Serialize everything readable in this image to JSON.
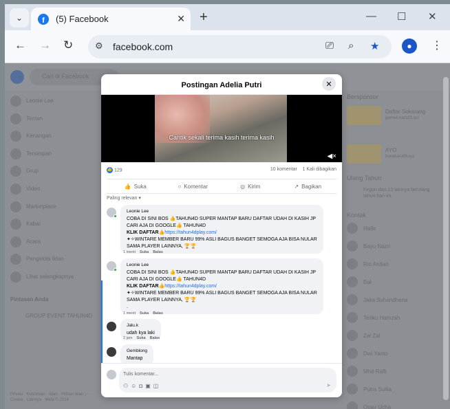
{
  "browser": {
    "tab_title": "(5) Facebook",
    "fb_favicon": "f",
    "url": "facebook.com",
    "icons": [
      "tab-search-icon",
      "close-icon",
      "new-tab-icon",
      "minimize-icon",
      "maximize-icon",
      "close-window-icon",
      "back-icon",
      "forward-icon",
      "reload-icon",
      "site-info-icon",
      "install-app-icon",
      "zoom-icon",
      "bookmark-star-icon",
      "profile-icon",
      "menu-icon"
    ]
  },
  "background": {
    "search_placeholder": "Cari di Facebook",
    "left_nav": [
      "Leonie Lee",
      "Teman",
      "Kenangan",
      "Tersimpan",
      "Grup",
      "Video",
      "Marketplace",
      "Kabar",
      "Acara",
      "Pengelola Iklan",
      "Lihat selengkapnya"
    ],
    "shortcuts_title": "Pintasan Anda",
    "shortcuts": [
      "GROUP EVENT TAHUN4D"
    ],
    "footer": "Privasi · Ketentuan · Iklan · Pilihan Iklan ▷ · Cookie · Lainnya · Meta © 2024",
    "sponsored_title": "Bersponsor",
    "sponsored": [
      {
        "title": "Daftar Sekarang",
        "sub": "game4.bar123.xyz"
      },
      {
        "title": "AYO",
        "sub": "bonsbaru99.xyz"
      }
    ],
    "birthday_title": "Ulang Tahun",
    "birthday_text": "Firgon dan 13 lainnya berulang tahun hari ini.",
    "contacts_title": "Kontak",
    "contacts": [
      "Hafis",
      "Bayu Nazri",
      "Rio Ardian",
      "Bal",
      "Jaka Suhandhana",
      "Tenku Hamzah",
      "Zal Zal",
      "Dwi Yanto",
      "Mhd Rafli",
      "Putra Suilla",
      "Ogay Ucha"
    ],
    "notif_count": "5"
  },
  "modal": {
    "title": "Postingan Adelia Putri",
    "video_caption": "Cantik sekali terima kasih terima kasih",
    "likes": "129",
    "comments_count": "10 komentar",
    "shares": "1 Kali dibagikan",
    "actions": {
      "like": "Suka",
      "comment": "Komentar",
      "send": "Kirim",
      "share": "Bagikan"
    },
    "sort_label": "Paling relevan",
    "comments": [
      {
        "name": "Leonie Lee",
        "line1": "COBA DI SINI BOS 👍TAHUN4D SUPER MANTAP BARU DAFTAR UDAH DI KASIH JP",
        "line2": "CARI AJA DI GOOGLE👍 TAHUN4D",
        "line3_label": "KLIK DAFTAR👍",
        "line3_link": "https://tahun4dplay.com/",
        "line4": "✦✧WINTARE MEMBER BARU 99% ASLI BAGUS BANGET SEMOGA AJA BISA NULAR",
        "line5": "SAMA PLAYER LAINNYA, 🏆🏆",
        "time": "1 menit",
        "like": "Suka",
        "reply": "Balas"
      },
      {
        "name": "Leonie Lee",
        "line1": "COBA DI SINI BOS 👍TAHUN4D SUPER MANTAP BARU DAFTAR UDAH DI KASIH JP",
        "line2": "CARI AJA DI GOOGLE👍 TAHUN4D",
        "line3_label": "KLIK DAFTAR👍",
        "line3_link": "https://tahun4dplay.com/",
        "line4": "✦✧WINTARE MEMBER BARU 99% ASLI BAGUS BANGET SEMOGA AJA BISA NULAR",
        "line5": "SAMA PLAYER LAINNYA, 🏆🏆",
        "line6": ".",
        "time": "1 menit",
        "like": "Suka",
        "reply": "Balas"
      },
      {
        "name": "Jalu.k",
        "text": "udah kya laki",
        "time": "2 jam",
        "like": "Suka",
        "reply": "Balas"
      },
      {
        "name": "Gemblong",
        "text": "Mantap"
      }
    ],
    "composer_placeholder": "Tulis komentar..."
  }
}
